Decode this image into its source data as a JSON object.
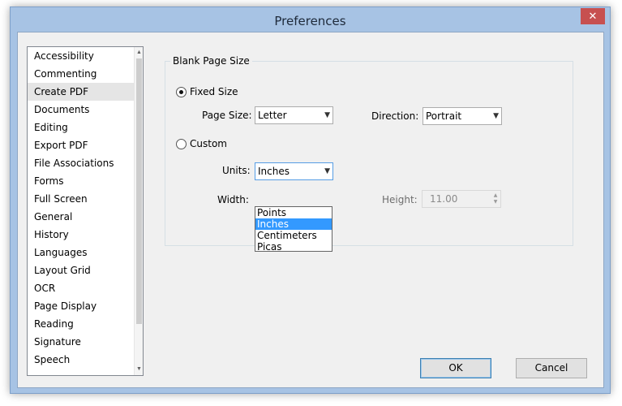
{
  "window": {
    "title": "Preferences",
    "close_glyph": "✕"
  },
  "sidebar": {
    "items": [
      {
        "label": "Accessibility"
      },
      {
        "label": "Commenting"
      },
      {
        "label": "Create PDF",
        "selected": true
      },
      {
        "label": "Documents"
      },
      {
        "label": "Editing"
      },
      {
        "label": "Export PDF"
      },
      {
        "label": "File Associations"
      },
      {
        "label": "Forms"
      },
      {
        "label": "Full Screen"
      },
      {
        "label": "General"
      },
      {
        "label": "History"
      },
      {
        "label": "Languages"
      },
      {
        "label": "Layout Grid"
      },
      {
        "label": "OCR"
      },
      {
        "label": "Page Display"
      },
      {
        "label": "Reading"
      },
      {
        "label": "Signature"
      },
      {
        "label": "Speech"
      }
    ]
  },
  "panel": {
    "group_title": "Blank Page Size",
    "fixed_size": {
      "label": "Fixed Size",
      "checked": true
    },
    "page_size": {
      "label": "Page Size:",
      "value": "Letter"
    },
    "direction": {
      "label": "Direction:",
      "value": "Portrait"
    },
    "custom": {
      "label": "Custom",
      "checked": false
    },
    "units": {
      "label": "Units:",
      "value": "Inches",
      "options": [
        "Points",
        "Inches",
        "Centimeters",
        "Picas"
      ],
      "highlighted": "Inches"
    },
    "width": {
      "label": "Width:"
    },
    "height": {
      "label": "Height:",
      "value": "11.00"
    }
  },
  "buttons": {
    "ok": "OK",
    "cancel": "Cancel"
  },
  "icons": {
    "chevron": "chevron-down-icon",
    "close": "close-icon"
  }
}
